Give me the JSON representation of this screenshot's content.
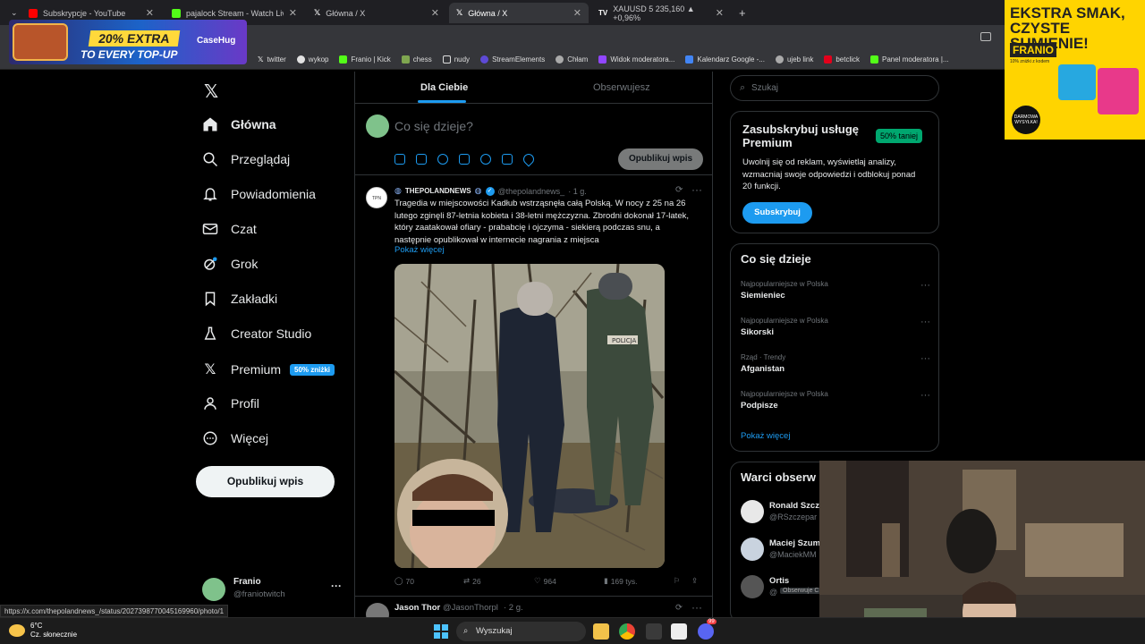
{
  "browser": {
    "tabs": [
      {
        "label": "Subskrypcje - YouTube",
        "color": "#ff0000"
      },
      {
        "label": "pajalock Stream - Watch Live o",
        "color": "#53fc18"
      },
      {
        "label": "Główna / X",
        "color": "#ffffff"
      },
      {
        "label": "Główna / X",
        "color": "#ffffff"
      },
      {
        "label": "XAUUSD 5 235,160 ▲ +0,96%",
        "color": "#ffffff"
      }
    ],
    "new_tab": "+",
    "bookmarks": [
      {
        "label": "twitter",
        "icon": "x-icon"
      },
      {
        "label": "wykop",
        "icon": "wykop-icon"
      },
      {
        "label": "Franio | Kick",
        "icon": "kick-icon"
      },
      {
        "label": "chess",
        "icon": "chess-icon"
      },
      {
        "label": "nudy",
        "icon": "folder-icon"
      },
      {
        "label": "StreamElements",
        "icon": "streamelements-icon"
      },
      {
        "label": "Chłam",
        "icon": "globe-icon"
      },
      {
        "label": "Widok moderatora...",
        "icon": "twitch-icon"
      },
      {
        "label": "Kalendarz Google -...",
        "icon": "calendar-icon"
      },
      {
        "label": "ujeb link",
        "icon": "globe-icon"
      },
      {
        "label": "betclick",
        "icon": "betclick-icon"
      },
      {
        "label": "Panel moderatora |...",
        "icon": "kick-icon"
      }
    ]
  },
  "ads": {
    "top": {
      "line1": "20% EXTRA",
      "line2": "TO EVERY TOP-UP",
      "brand": "CaseHug"
    },
    "right": {
      "headline": "EKSTRA SMAK, CZYSTE SUMIENIE!",
      "brand": "FRANIO",
      "small": "10% zniżki z kodem",
      "badge": "DARMOWA WYSYŁKA!"
    }
  },
  "nav": {
    "items": [
      {
        "label": "Główna",
        "icon": "home-icon",
        "active": true
      },
      {
        "label": "Przeglądaj",
        "icon": "search-icon"
      },
      {
        "label": "Powiadomienia",
        "icon": "bell-icon"
      },
      {
        "label": "Czat",
        "icon": "mail-icon"
      },
      {
        "label": "Grok",
        "icon": "grok-icon"
      },
      {
        "label": "Zakładki",
        "icon": "bookmark-icon"
      },
      {
        "label": "Creator Studio",
        "icon": "flask-icon"
      },
      {
        "label": "Premium",
        "icon": "x-icon",
        "badge": "50% zniżki"
      },
      {
        "label": "Profil",
        "icon": "person-icon"
      },
      {
        "label": "Więcej",
        "icon": "more-circle-icon"
      }
    ],
    "post_button": "Opublikuj wpis",
    "profile": {
      "name": "Franio",
      "handle": "@franiotwitch",
      "more": "···"
    }
  },
  "feed": {
    "tabs": [
      "Dla Ciebie",
      "Obserwujesz"
    ],
    "composer": {
      "placeholder": "Co się dzieje?",
      "button": "Opublikuj wpis"
    },
    "tweet": {
      "avatar_text": "TPN",
      "name": "THEPOLANDNEWS",
      "handle": "@thepolandnews_",
      "time": "· 1 g.",
      "text": "Tragedia w miejscowości Kadłub wstrząsnęła całą Polską. W nocy z 25 na 26 lutego zginęli 87-letnia kobieta i 38-letni mężczyzna. Zbrodni dokonał 17-latek, który zaatakował ofiary - prababcię i ojczyma - siekierą podczas snu, a następnie opublikował w internecie nagrania z miejsca",
      "show_more": "Pokaż więcej",
      "media_label": "POLICJA",
      "actions": {
        "replies": "70",
        "reposts": "26",
        "likes": "964",
        "views": "169 tys."
      }
    },
    "tweet2": {
      "name": "Jason Thor",
      "handle": "@JasonThorpl",
      "time": "· 2 g."
    }
  },
  "right": {
    "search_placeholder": "Szukaj",
    "premium": {
      "title": "Zasubskrybuj usługę Premium",
      "discount": "50% taniej",
      "desc": "Uwolnij się od reklam, wyświetlaj analizy, wzmacniaj swoje odpowiedzi i odblokuj ponad 20 funkcji.",
      "button": "Subskrybuj"
    },
    "trends": {
      "title": "Co się dzieje",
      "items": [
        {
          "meta": "Najpopularniejsze w Polska",
          "name": "Siemieniec"
        },
        {
          "meta": "Najpopularniejsze w Polska",
          "name": "Sikorski"
        },
        {
          "meta": "Rząd · Trendy",
          "name": "Afganistan"
        },
        {
          "meta": "Najpopularniejsze w Polska",
          "name": "Podpisze"
        }
      ],
      "show_more": "Pokaż więcej"
    },
    "follow": {
      "title": "Warci obserw",
      "items": [
        {
          "name": "Ronald Szcz",
          "handle": "@RSzczepar"
        },
        {
          "name": "Maciej Szum",
          "handle": "@MaciekMM"
        },
        {
          "name": "Ortis",
          "handle": "@",
          "badge": "Obserwuje Cię"
        }
      ]
    }
  },
  "status_url": "https://x.com/thepolandnews_/status/2027398770045169960/photo/1",
  "taskbar": {
    "temp": "6°C",
    "weather": "Cz. słonecznie",
    "search": "Wyszukaj",
    "badge": "99"
  }
}
